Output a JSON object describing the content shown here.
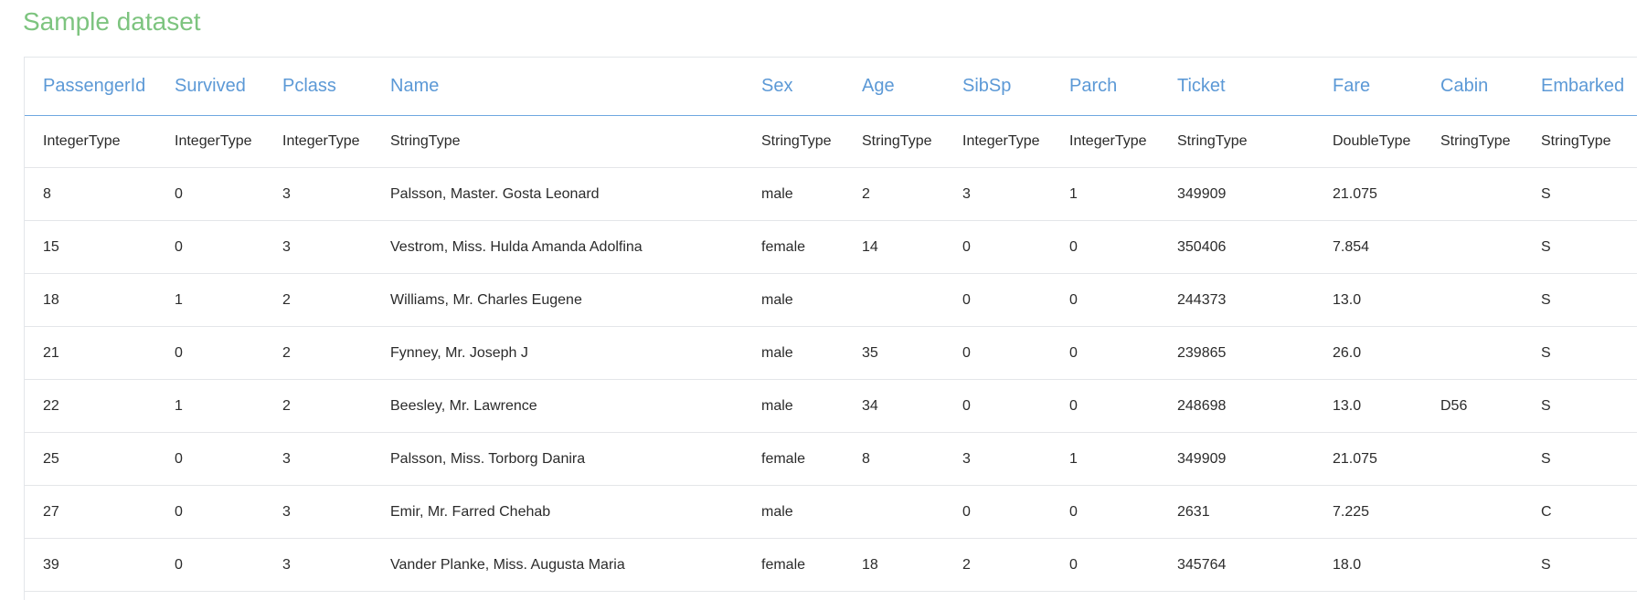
{
  "title": "Sample dataset",
  "columns": [
    "PassengerId",
    "Survived",
    "Pclass",
    "Name",
    "Sex",
    "Age",
    "SibSp",
    "Parch",
    "Ticket",
    "Fare",
    "Cabin",
    "Embarked"
  ],
  "types": [
    "IntegerType",
    "IntegerType",
    "IntegerType",
    "StringType",
    "StringType",
    "StringType",
    "IntegerType",
    "IntegerType",
    "StringType",
    "DoubleType",
    "StringType",
    "StringType"
  ],
  "rows": [
    [
      "8",
      "0",
      "3",
      "Palsson, Master. Gosta Leonard",
      "male",
      "2",
      "3",
      "1",
      "349909",
      "21.075",
      "",
      "S"
    ],
    [
      "15",
      "0",
      "3",
      "Vestrom, Miss. Hulda Amanda Adolfina",
      "female",
      "14",
      "0",
      "0",
      "350406",
      "7.854",
      "",
      "S"
    ],
    [
      "18",
      "1",
      "2",
      "Williams, Mr. Charles Eugene",
      "male",
      "",
      "0",
      "0",
      "244373",
      "13.0",
      "",
      "S"
    ],
    [
      "21",
      "0",
      "2",
      "Fynney, Mr. Joseph J",
      "male",
      "35",
      "0",
      "0",
      "239865",
      "26.0",
      "",
      "S"
    ],
    [
      "22",
      "1",
      "2",
      "Beesley, Mr. Lawrence",
      "male",
      "34",
      "0",
      "0",
      "248698",
      "13.0",
      "D56",
      "S"
    ],
    [
      "25",
      "0",
      "3",
      "Palsson, Miss. Torborg Danira",
      "female",
      "8",
      "3",
      "1",
      "349909",
      "21.075",
      "",
      "S"
    ],
    [
      "27",
      "0",
      "3",
      "Emir, Mr. Farred Chehab",
      "male",
      "",
      "0",
      "0",
      "2631",
      "7.225",
      "",
      "C"
    ],
    [
      "39",
      "0",
      "3",
      "Vander Planke, Miss. Augusta Maria",
      "female",
      "18",
      "2",
      "0",
      "345764",
      "18.0",
      "",
      "S"
    ]
  ]
}
